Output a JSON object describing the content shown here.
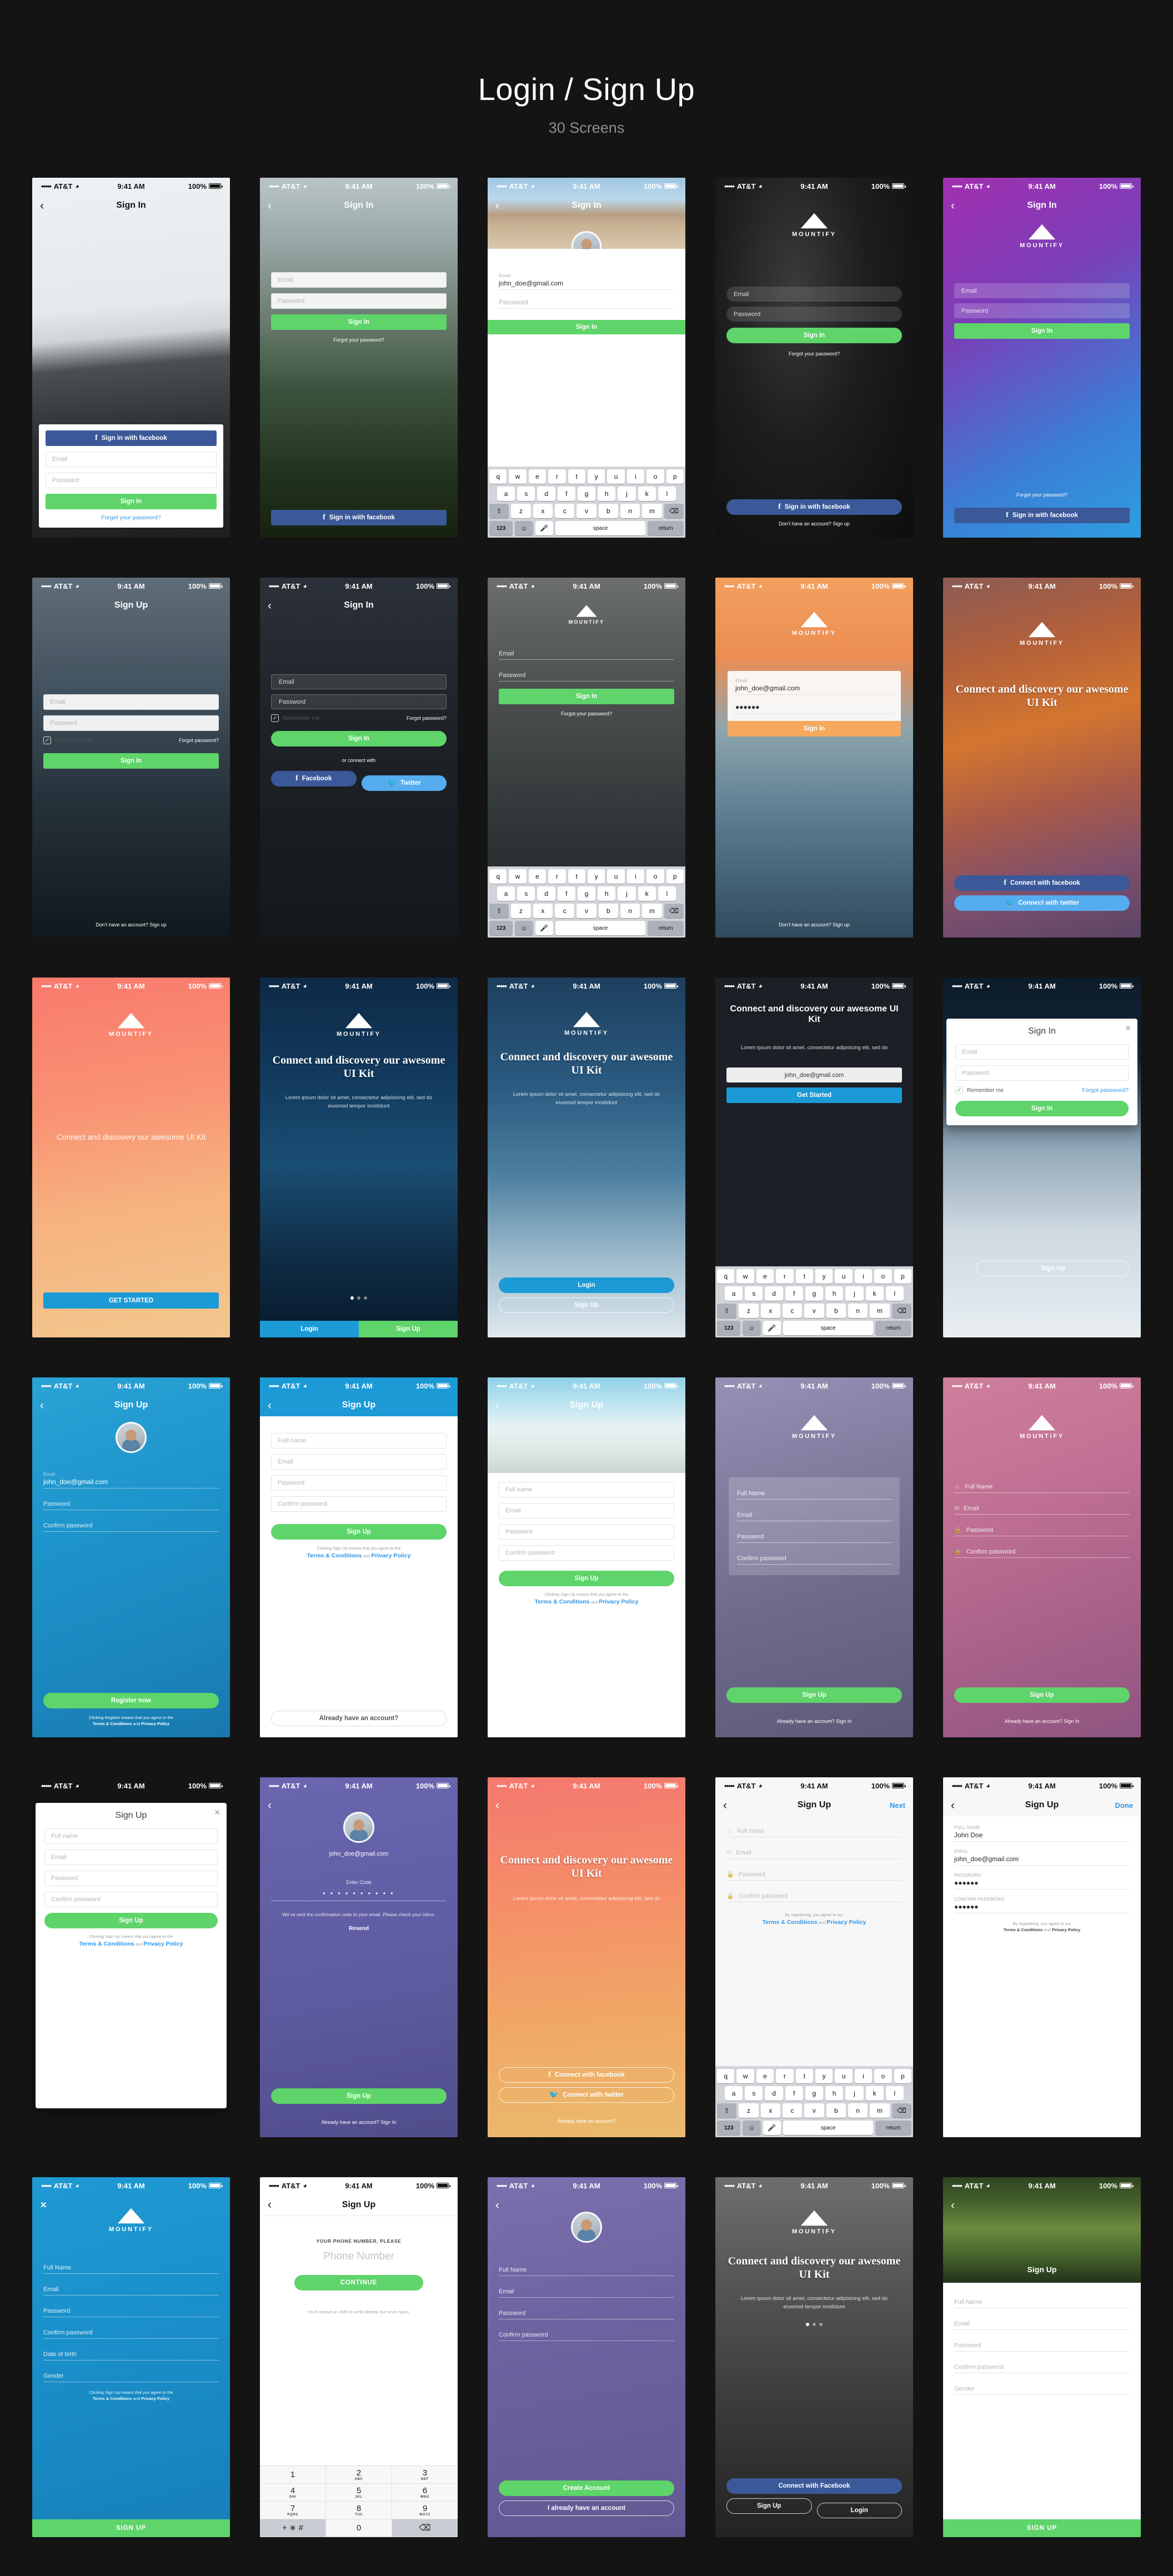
{
  "page": {
    "title": "Login / Sign Up",
    "subtitle": "30 Screens"
  },
  "common": {
    "carrier": "AT&T",
    "dots": "•••••",
    "time": "9:41 AM",
    "battery": "100%",
    "back_icon": "chevron-left-icon",
    "brand": "MOUNTIFY",
    "labels": {
      "sign_in": "Sign In",
      "sign_up": "Sign Up",
      "login": "Login",
      "email": "Email",
      "password": "Password",
      "confirm_password": "Confirm password",
      "full_name": "Full name",
      "full_name_typo": "Fulll name",
      "full_name_cap": "Full Name",
      "date_of_birth": "Date of birth",
      "gender": "Gender",
      "remember_me": "Remember me",
      "forgot_password_q": "Forgot password?",
      "forgot_your_password": "Forgot your password?",
      "fb_signin": "Sign in with facebook",
      "fb_connect": "Connect with facebook",
      "tw_connect": "Connect with twitter",
      "fb_connect_cap": "Connect with Facebook",
      "no_account": "Don’t have an account? Sign up",
      "have_account_q": "Already have an account?",
      "have_account_signin": "Already have an account? Sign In",
      "or_connect_with": "or connect with",
      "facebook": "Facebook",
      "twitter": "Twitter",
      "get_started": "GET STARTED",
      "get_started_c": "Get Started",
      "register_now": "Register now",
      "create_account": "Create Account",
      "already_account_btn": "I already have an account",
      "signup_caps": "SIGN UP",
      "next": "Next",
      "done": "Done",
      "resend": "Resend",
      "enter_code": "Enter Code",
      "continue": "CONTINUE",
      "email_value": "john_doe@gmail.com",
      "name_value": "John Doe",
      "password_mask": "●●●●●●",
      "code_mask": "• • • • • • • • • •",
      "headline": "Connect and discovery our awesome UI Kit",
      "lorem": "Lorem ipsum dolor sit amet, consectetur adipisicing elit, sed do eiusmod tempor incididunt",
      "lorem_short": "Lorem ipsum dolor sit amet, consectetur adipisicing elit, sed do",
      "terms_signup": "Clicking Sign Up means that you agree to the",
      "terms_register": "Clicking Register means that you agree to the",
      "terms_bylaw": "By registering, you agree to our",
      "terms_link": "Terms & Conditions",
      "and": "and",
      "privacy_link": "Privacy Policy",
      "confirm_sent": "We’ve sent the confirmation code to your email. Please check your inbox.",
      "phone_prompt": "YOUR PHONE NUMBER, PLEASE",
      "phone_placeholder": "Phone Number",
      "sms_note": "You’ll receive an SMS to verify identity, but never spam.",
      "fullname_caps": "FULL NAME",
      "email_caps": "EMAIL",
      "password_caps": "PASSWORD",
      "confirm_caps": "CONFIRM PASSWORD"
    },
    "keyboard": {
      "row1": [
        "q",
        "w",
        "e",
        "r",
        "t",
        "y",
        "u",
        "i",
        "o",
        "p"
      ],
      "row2": [
        "a",
        "s",
        "d",
        "f",
        "g",
        "h",
        "j",
        "k",
        "l"
      ],
      "row3": [
        "z",
        "x",
        "c",
        "v",
        "b",
        "n",
        "m"
      ],
      "shift": "⇧",
      "backspace": "⌫",
      "numeric": "123",
      "emoji": "☺",
      "mic": "⬤",
      "space": "space",
      "return": "return"
    },
    "dialpad": [
      {
        "n": "1",
        "s": ""
      },
      {
        "n": "2",
        "s": "ABC"
      },
      {
        "n": "3",
        "s": "DEF"
      },
      {
        "n": "4",
        "s": "GHI"
      },
      {
        "n": "5",
        "s": "JKL"
      },
      {
        "n": "6",
        "s": "MNO"
      },
      {
        "n": "7",
        "s": "PQRS"
      },
      {
        "n": "8",
        "s": "TUV"
      },
      {
        "n": "9",
        "s": "WXYZ"
      },
      {
        "n": "+ ∗ #",
        "s": ""
      },
      {
        "n": "0",
        "s": ""
      },
      {
        "n": "⌫",
        "s": ""
      }
    ],
    "colors": {
      "green": "#5ed46a",
      "facebook": "#3b5998",
      "twitter": "#55acee",
      "blue": "#1b9ad6",
      "link": "#2f96e8",
      "page_bg": "#141414"
    }
  }
}
